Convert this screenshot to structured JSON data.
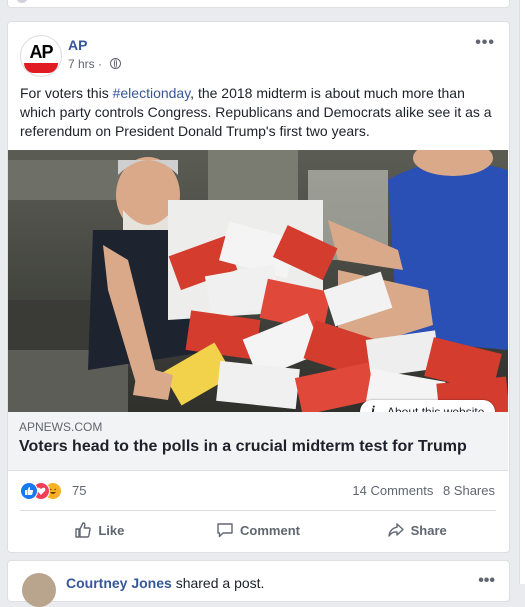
{
  "post": {
    "page_name": "AP",
    "avatar_text": "AP",
    "time": "7 hrs",
    "separator": "·",
    "text_before": "For voters this ",
    "hashtag": "#electionday",
    "text_after": ", the 2018 midterm is about much more than which party controls Congress. Republicans and Democrats alike see it as a referendum on President Donald Trump's first two years.",
    "more_label": "•••"
  },
  "link": {
    "domain": "APNEWS.COM",
    "headline": "Voters head to the polls in a crucial midterm test for Trump",
    "about_label": "About this website",
    "about_icon": "i"
  },
  "engagement": {
    "reaction_count": "75",
    "comments": "14 Comments",
    "shares": "8 Shares"
  },
  "actions": {
    "like": "Like",
    "comment": "Comment",
    "share": "Share"
  },
  "next_post": {
    "author": "Courtney Jones",
    "action": " shared a post.",
    "more_label": "•••"
  },
  "colors": {
    "link_blue": "#365899",
    "ap_red": "#e01b22",
    "like_blue": "#1877f2",
    "love_red": "#f33e58",
    "haha_yellow": "#f7b125"
  },
  "icons": [
    "globe-icon",
    "like-reaction-icon",
    "love-reaction-icon",
    "haha-reaction-icon",
    "thumbs-up-icon",
    "comment-icon",
    "share-icon",
    "info-icon"
  ]
}
